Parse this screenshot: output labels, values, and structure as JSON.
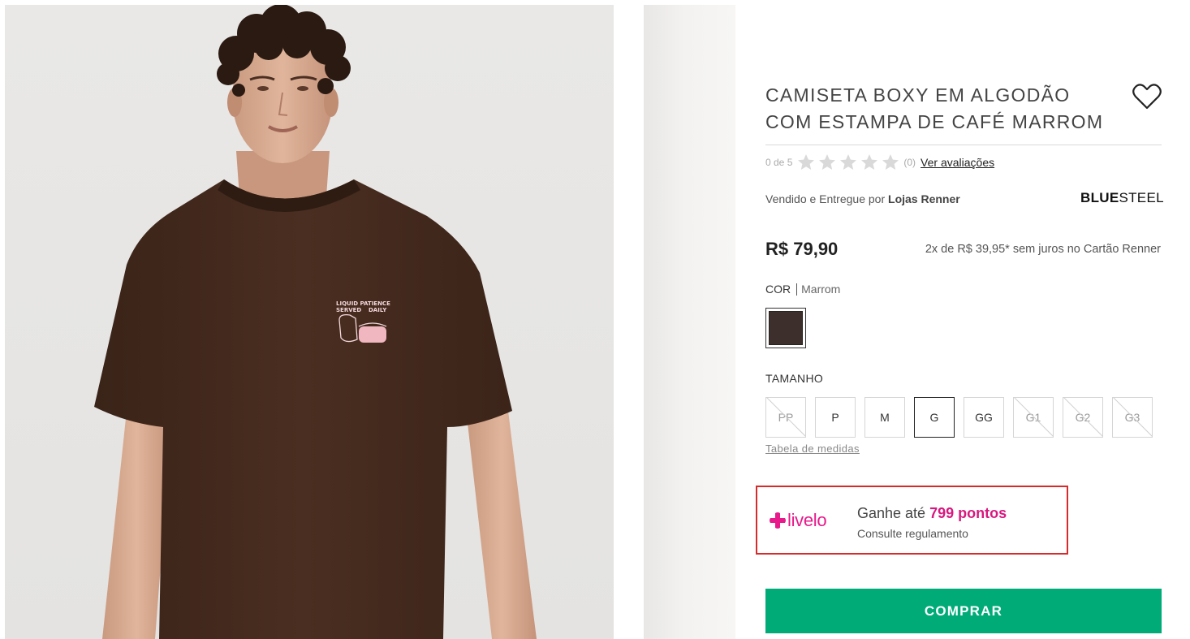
{
  "product": {
    "title_line1": "CAMISETA BOXY EM ALGODÃO",
    "title_line2": "COM ESTAMPA DE CAFÉ MARROM",
    "favorite_icon": "heart-outline-icon"
  },
  "rating": {
    "score_text": "0 de 5",
    "stars": 0,
    "max_stars": 5,
    "count_text": "(0)",
    "reviews_link": "Ver avaliações"
  },
  "seller": {
    "prefix": "Vendido e Entregue por",
    "name": "Lojas Renner"
  },
  "brand": {
    "part1": "BLUE",
    "part2": "STEEL"
  },
  "pricing": {
    "price": "R$ 79,90",
    "installments": "2x de R$ 39,95* sem juros no Cartão Renner"
  },
  "color": {
    "label": "COR",
    "value": "Marrom",
    "swatch_hex": "#3d302c"
  },
  "size": {
    "label": "TAMANHO",
    "options": [
      {
        "label": "PP",
        "available": false
      },
      {
        "label": "P",
        "available": true
      },
      {
        "label": "M",
        "available": true
      },
      {
        "label": "G",
        "available": true,
        "selected": true
      },
      {
        "label": "GG",
        "available": true
      },
      {
        "label": "G1",
        "available": false
      },
      {
        "label": "G2",
        "available": false
      },
      {
        "label": "G3",
        "available": false
      }
    ],
    "chart_link": "Tabela de medidas"
  },
  "livelo": {
    "logo_text": "livelo",
    "earn_prefix": "Ganhe até",
    "points": "799 pontos",
    "regulation": "Consulte regulamento",
    "brand_color": "#e8198b"
  },
  "buy_button": {
    "label": "COMPRAR",
    "color": "#00ab78"
  },
  "print_on_shirt": {
    "line1": "LIQUID PATIENCE",
    "line2": "SERVED",
    "line3": "DAILY"
  }
}
